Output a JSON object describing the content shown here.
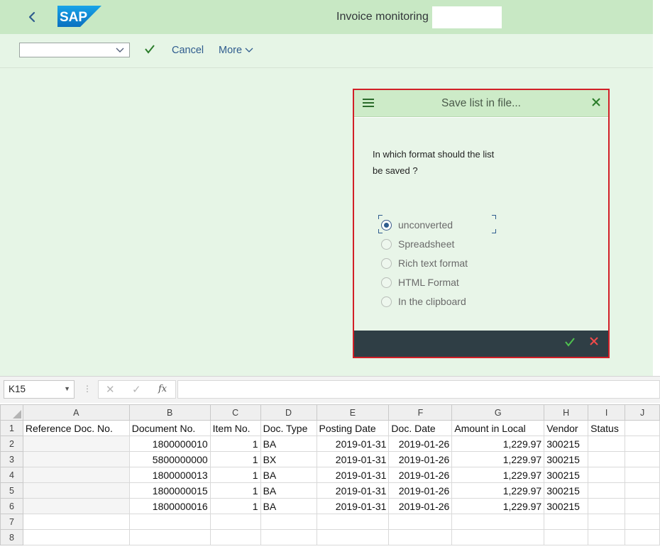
{
  "shell": {
    "title": "Invoice monitoring",
    "logo_text": "SAP"
  },
  "toolbar": {
    "select_value": "",
    "confirm_icon": "check-icon",
    "cancel_label": "Cancel",
    "more_label": "More"
  },
  "dialog": {
    "title": "Save list in file...",
    "question_line1": "In which format should the list",
    "question_line2": "be saved ?",
    "options": [
      {
        "label": "unconverted",
        "selected": true
      },
      {
        "label": "Spreadsheet",
        "selected": false
      },
      {
        "label": "Rich text format",
        "selected": false
      },
      {
        "label": "HTML Format",
        "selected": false
      },
      {
        "label": "In the clipboard",
        "selected": false
      }
    ],
    "colors": {
      "header": "#cdebc8",
      "body": "#e8f5e8",
      "footer": "#2f3e45",
      "focus_border": "#d21f27"
    }
  },
  "excel": {
    "name_box": "K15",
    "formula": "",
    "fx_label": "fx",
    "columns": [
      "A",
      "B",
      "C",
      "D",
      "E",
      "F",
      "G",
      "H",
      "I",
      "J"
    ],
    "row_numbers": [
      "1",
      "2",
      "3",
      "4",
      "5",
      "6",
      "7",
      "8"
    ],
    "headers": [
      "Reference Doc. No.",
      "Document No.",
      "Item No.",
      "Doc. Type",
      "Posting Date",
      "Doc. Date",
      "Amount in Local",
      "Vendor",
      "Status",
      ""
    ],
    "rows": [
      [
        "",
        "1800000010",
        "1",
        "BA",
        "2019-01-31",
        "2019-01-26",
        "1,229.97",
        "300215",
        "",
        ""
      ],
      [
        "",
        "5800000000",
        "1",
        "BX",
        "2019-01-31",
        "2019-01-26",
        "1,229.97",
        "300215",
        "",
        ""
      ],
      [
        "",
        "1800000013",
        "1",
        "BA",
        "2019-01-31",
        "2019-01-26",
        "1,229.97",
        "300215",
        "",
        ""
      ],
      [
        "",
        "1800000015",
        "1",
        "BA",
        "2019-01-31",
        "2019-01-26",
        "1,229.97",
        "300215",
        "",
        ""
      ],
      [
        "",
        "1800000016",
        "1",
        "BA",
        "2019-01-31",
        "2019-01-26",
        "1,229.97",
        "300215",
        "",
        ""
      ],
      [
        "",
        "",
        "",
        "",
        "",
        "",
        "",
        "",
        "",
        ""
      ],
      [
        "",
        "",
        "",
        "",
        "",
        "",
        "",
        "",
        "",
        ""
      ]
    ]
  }
}
